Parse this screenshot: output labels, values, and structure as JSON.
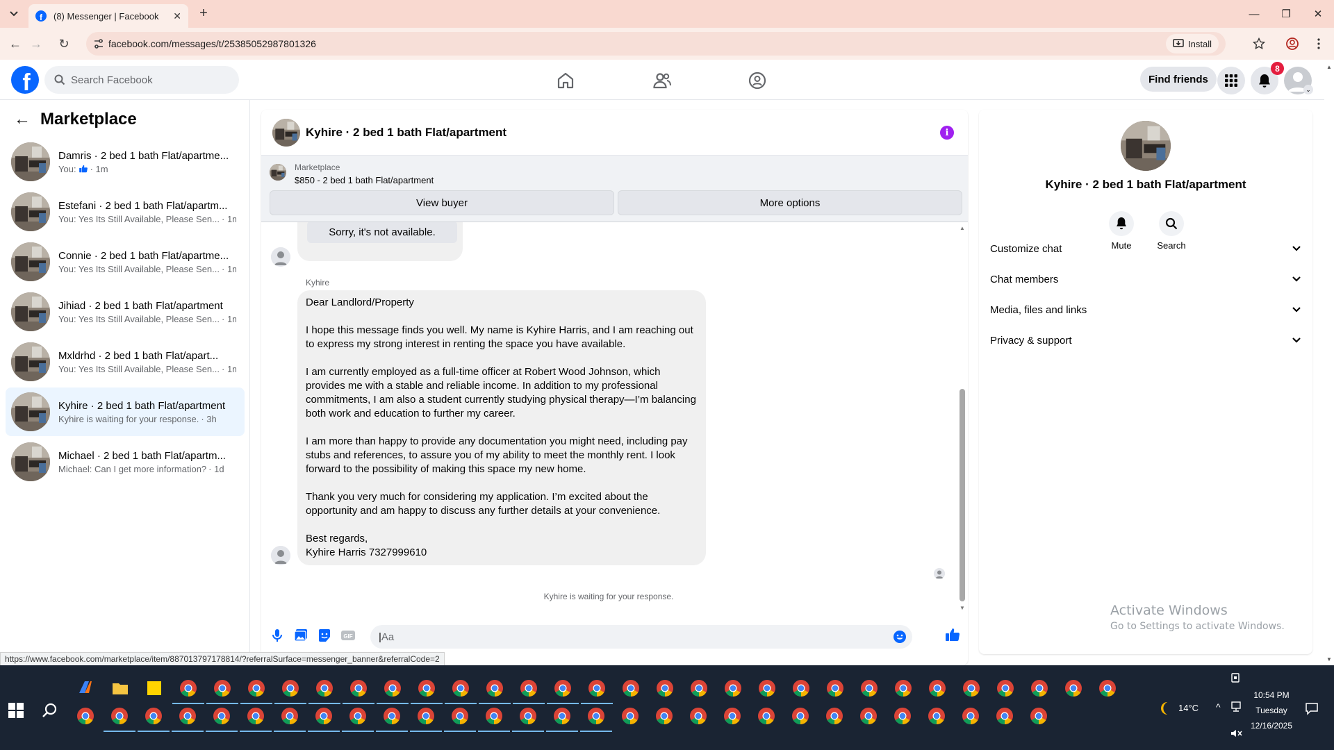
{
  "browser": {
    "tab_title": "(8) Messenger | Facebook",
    "url": "facebook.com/messages/t/25385052987801326",
    "install_label": "Install",
    "status_url": "https://www.facebook.com/marketplace/item/887013797178814/?referralSurface=messenger_banner&referralCode=2"
  },
  "fb_nav": {
    "search_placeholder": "Search Facebook",
    "find_friends_label": "Find friends",
    "notification_count": "8"
  },
  "sidebar": {
    "title": "Marketplace",
    "conversations": [
      {
        "title": "Damris · 2 bed 1 bath Flat/apartme...",
        "subtitle": "You:",
        "time": "· 1m",
        "thumb_icon": true
      },
      {
        "title": "Estefani · 2 bed 1 bath Flat/apartm...",
        "subtitle": "You: Yes Its Still Available, Please Sen...",
        "time": "· 1m"
      },
      {
        "title": "Connie · 2 bed 1 bath Flat/apartme...",
        "subtitle": "You: Yes Its Still Available, Please Sen...",
        "time": "· 1m"
      },
      {
        "title": "Jihiad · 2 bed 1 bath Flat/apartment",
        "subtitle": "You: Yes Its Still Available, Please Sen...",
        "time": "· 1m"
      },
      {
        "title": "Mxldrhd · 2 bed 1 bath Flat/apart...",
        "subtitle": "You: Yes Its Still Available, Please Sen...",
        "time": "· 1m"
      },
      {
        "title": "Kyhire · 2 bed 1 bath Flat/apartment",
        "subtitle": "Kyhire is waiting for your response.",
        "time": "· 3h",
        "active": true
      },
      {
        "title": "Michael · 2 bed 1 bath Flat/apartm...",
        "subtitle": "Michael: Can I get more information?",
        "time": "· 1d"
      }
    ]
  },
  "chat": {
    "title": "Kyhire · 2 bed 1 bath Flat/apartment",
    "banner": {
      "source": "Marketplace",
      "item": "$850 - 2 bed 1 bath Flat/apartment",
      "view_buyer": "View buyer",
      "more_options": "More options"
    },
    "prev_bubble": "Sorry, it's not available.",
    "sender_name": "Kyhire",
    "message_paragraphs": [
      "Dear Landlord/Property",
      "I hope this message finds you well. My name is Kyhire Harris, and I am reaching out to express my strong interest in renting the space you have available.",
      "I am currently employed as a full-time officer at Robert Wood Johnson, which provides me with a stable and reliable income. In addition to my professional commitments, I am also a student currently studying physical therapy—I’m balancing both work and education to further my career.",
      "I am more than happy to provide any documentation you might need, including pay stubs and references, to assure you of my ability to meet the monthly rent. I look forward to the possibility of making this space my new home.",
      "Thank you very much for considering my application. I’m excited about the opportunity and am happy to discuss any further details at your convenience.",
      "Best regards,\nKyhire Harris 7327999610"
    ],
    "waiting_note": "Kyhire is waiting for your response.",
    "input_placeholder": "Aa"
  },
  "info_panel": {
    "title": "Kyhire · 2 bed 1 bath Flat/apartment",
    "mute_label": "Mute",
    "search_label": "Search",
    "rows": [
      "Customize chat",
      "Chat members",
      "Media, files and links",
      "Privacy & support"
    ]
  },
  "watermark": {
    "line1": "Activate Windows",
    "line2": "Go to Settings to activate Windows."
  },
  "taskbar": {
    "weather": "14°C",
    "time": "10:54 PM",
    "day": "Tuesday",
    "date": "12/16/2025"
  },
  "colors": {
    "fb_blue": "#0866ff",
    "chrome_tab": "#f9d9d0",
    "active_convo": "#ebf5ff",
    "info_purple": "#a020f0",
    "badge_red": "#e41e3f",
    "taskbar": "#1a2433"
  }
}
